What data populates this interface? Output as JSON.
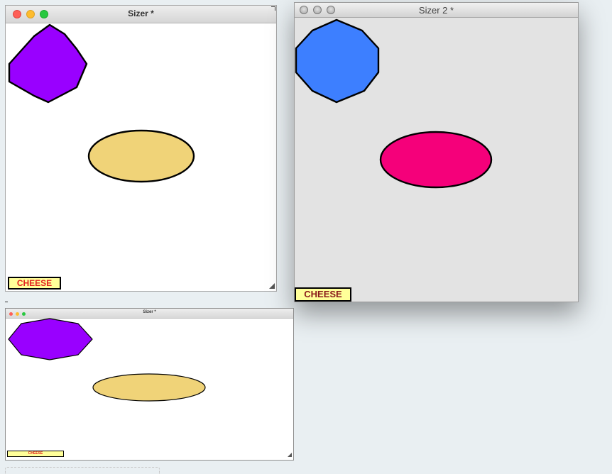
{
  "windows": {
    "main": {
      "title": "Sizer *",
      "badge_label": "CHEESE",
      "shapes": [
        {
          "kind": "octagon",
          "fill": "#9900ff"
        },
        {
          "kind": "ellipse",
          "fill": "#f0d378"
        }
      ]
    },
    "second": {
      "title": "Sizer 2 *",
      "badge_label": "CHEESE",
      "shapes": [
        {
          "kind": "octagon",
          "fill": "#3d7fff"
        },
        {
          "kind": "ellipse",
          "fill": "#f5007a"
        }
      ]
    },
    "thumbnail": {
      "title": "Sizer *",
      "badge_label": "CHEESE",
      "shapes": [
        {
          "kind": "octagon",
          "fill": "#9900ff"
        },
        {
          "kind": "ellipse",
          "fill": "#f0d378"
        }
      ]
    }
  },
  "colors": {
    "traffic_close": "#fe5f57",
    "traffic_minimize": "#febc2e",
    "traffic_zoom": "#28c840",
    "cheese_background": "#ffff99",
    "cheese_text_main": "#e32420",
    "cheese_text_second": "#8a1a1a",
    "desktop": "#e9eff2"
  },
  "icons": [
    "close-icon",
    "minimize-icon",
    "zoom-icon",
    "resize-grip-icon"
  ]
}
